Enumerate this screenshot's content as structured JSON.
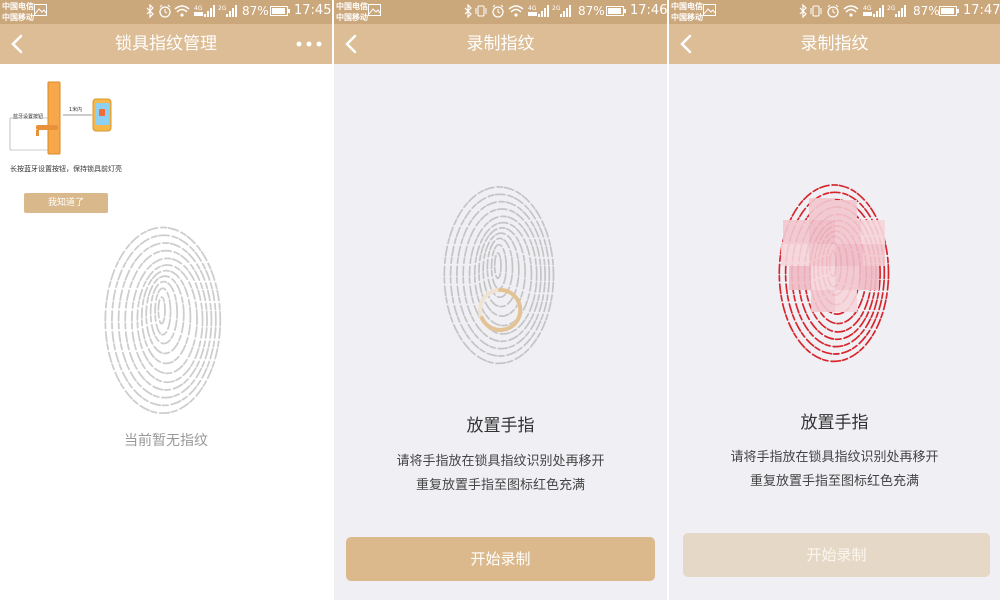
{
  "status_bar": {
    "carrier_1": "中国电信",
    "carrier_2": "中国移动",
    "network_labels": [
      "4G",
      "2G"
    ],
    "battery_percent": "87%",
    "times": [
      "17:45",
      "17:46",
      "17:47"
    ]
  },
  "screens": [
    {
      "title": "锁具指纹管理",
      "diagram": {
        "button_label": "蓝牙设置按钮",
        "distance_label": "1米内"
      },
      "hint": "长按蓝牙设置按钮，保持锁具前灯亮",
      "ack_button": "我知道了",
      "empty_text": "当前暂无指纹"
    },
    {
      "title": "录制指纹",
      "place_title": "放置手指",
      "instruction_1": "请将手指放在锁具指纹识别处再移开",
      "instruction_2": "重复放置手指至图标红色充满",
      "start_button": "开始录制"
    },
    {
      "title": "录制指纹",
      "place_title": "放置手指",
      "instruction_1": "请将手指放在锁具指纹识别处再移开",
      "instruction_2": "重复放置手指至图标红色充满",
      "start_button": "开始录制"
    }
  ],
  "colors": {
    "status_bar": "#cba77c",
    "nav_bar": "#ddbd96",
    "button_active": "#dbb98e",
    "button_disabled": "#e6d8c6",
    "fingerprint_empty": "#c8c8c8",
    "fingerprint_filled": "#d8252c",
    "progress_ring": "#e8c79b"
  },
  "icons": [
    "back-arrow-icon",
    "more-dots-icon",
    "bluetooth-icon",
    "alarm-icon",
    "wifi-icon",
    "signal-icon",
    "battery-icon",
    "gallery-icon",
    "fingerprint-icon"
  ]
}
